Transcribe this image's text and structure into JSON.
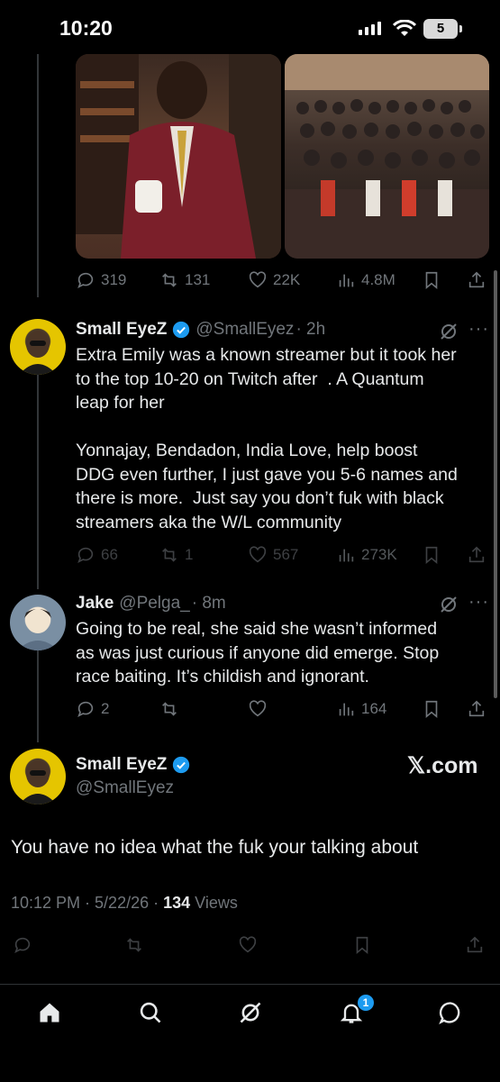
{
  "status": {
    "time": "10:20",
    "battery": "5"
  },
  "colors": {
    "accent": "#1d9bf0",
    "background": "#000000",
    "muted": "#71767b"
  },
  "tweet1_actions": {
    "replies": "319",
    "reposts": "131",
    "likes": "22K",
    "views": "4.8M"
  },
  "tweet2": {
    "name": "Small EyeZ",
    "handle": "@SmallEyez",
    "time": "· 2h",
    "text": "Extra Emily was a known streamer but it took her\nto the top 10-20 on Twitch after  . A Quantum\nleap for her\n\nYonnajay, Bendadon, India Love, help boost\nDDG even further, I just gave you 5-6 names and\nthere is more.  Just say you don’t fuk with black\nstreamers aka the W/L community",
    "replies": "66",
    "reposts": "1",
    "likes": "567",
    "views": "273K"
  },
  "tweet3": {
    "name": "Jake",
    "handle": "@Pelga_",
    "time": "· 8m",
    "text": "Going to be real, she said she wasn’t informed\nas was just curious if anyone did emerge. Stop\nrace baiting. It’s childish and ignorant.",
    "replies": "2",
    "views": "164"
  },
  "main": {
    "name": "Small EyeZ",
    "handle": "@SmallEyez",
    "brand": "𝕏.com",
    "text": "You have no idea what the fuk your talking about",
    "meta_prefix": "10:12 PM · 5/22/26 · ",
    "views_count": "134",
    "views_label": " Views"
  },
  "tabbar": {
    "notifications_badge": "1"
  },
  "icons": [
    "reply-icon",
    "repost-icon",
    "like-icon",
    "views-icon",
    "bookmark-icon",
    "share-icon",
    "grok-icon",
    "more-icon",
    "home-icon",
    "search-icon",
    "notifications-icon",
    "messages-icon",
    "verified-badge-icon"
  ]
}
